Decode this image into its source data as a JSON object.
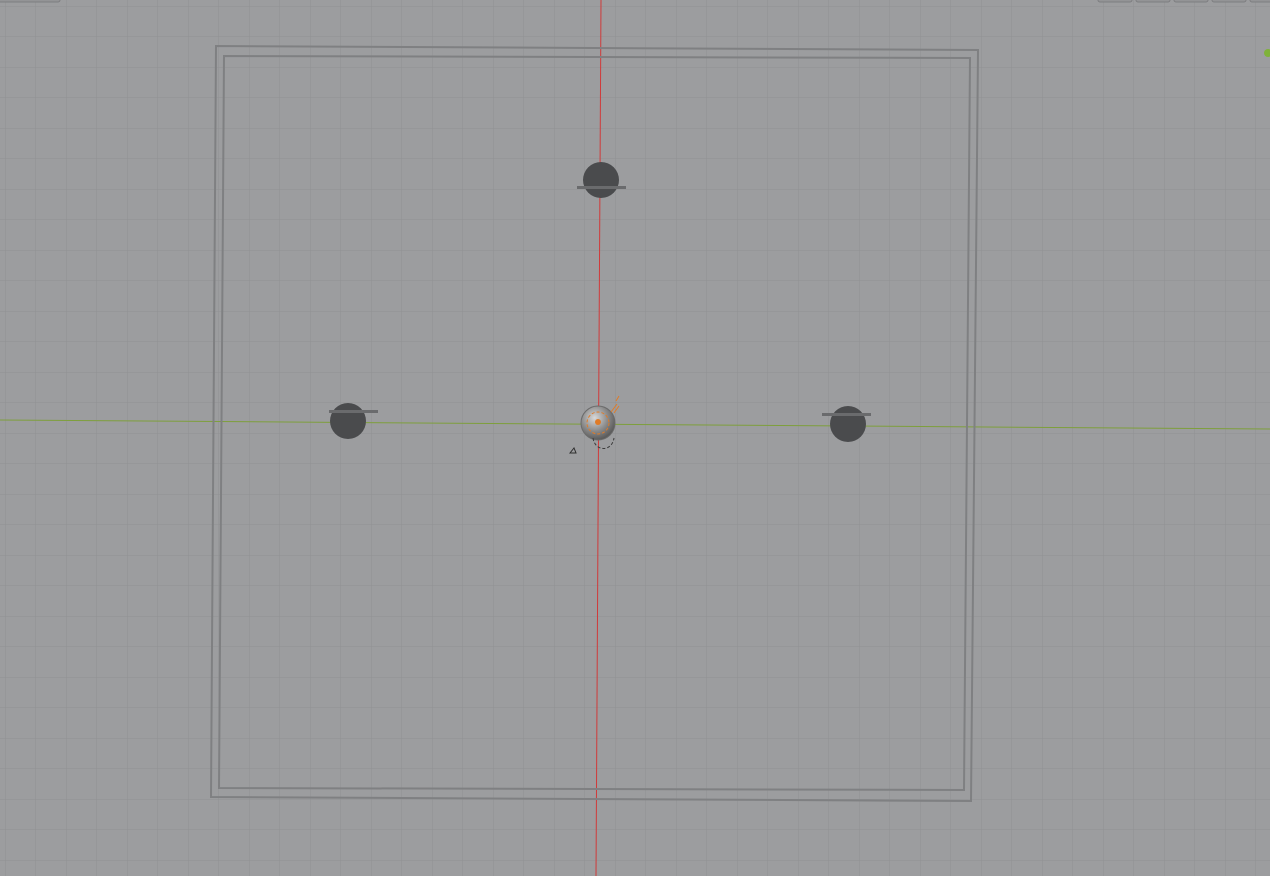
{
  "viewport": {
    "view": "top-orthographic",
    "background_color": "#9c9d9f",
    "grid": true,
    "grid_color": "#8f9092",
    "x_axis_color": "#7e9f3c",
    "y_axis_color": "#d03a3a",
    "selection_color": "#e07b27"
  },
  "scene_objects": [
    {
      "name": "room-walls",
      "icon": "mesh-outline"
    },
    {
      "name": "light-top",
      "icon": "light-point"
    },
    {
      "name": "light-left",
      "icon": "light-point"
    },
    {
      "name": "light-right",
      "icon": "light-point"
    },
    {
      "name": "origin-object",
      "icon": "selected-object",
      "selected": true
    },
    {
      "name": "camera-marker",
      "icon": "camera-icon"
    }
  ]
}
